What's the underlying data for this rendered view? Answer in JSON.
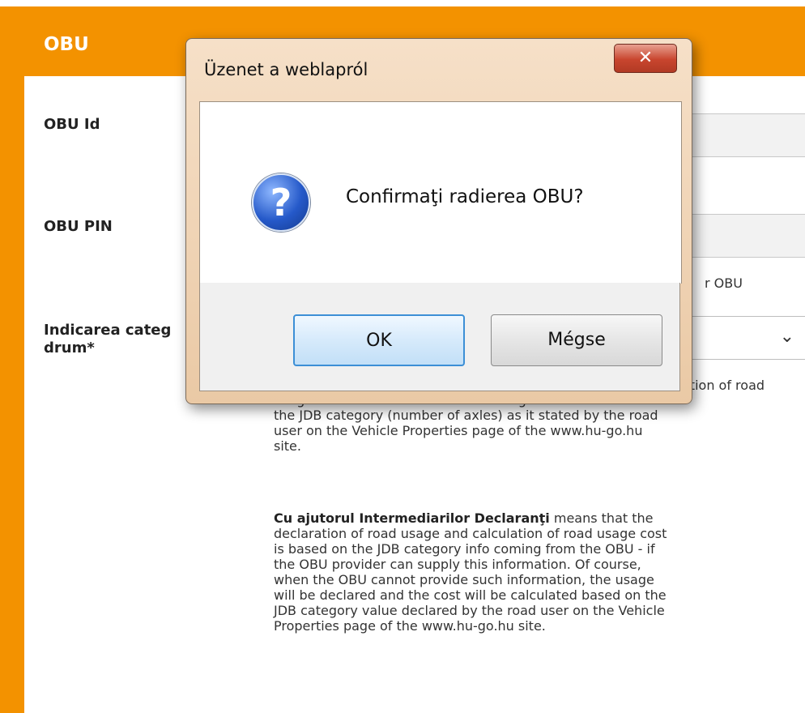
{
  "panel": {
    "title": "OBU",
    "accent_color": "#f39200"
  },
  "form": {
    "obu_id_label": "OBU Id",
    "obu_pin_label": "OBU PIN",
    "obu_hint_partial": "r OBU",
    "category_label_line1": "Indicarea categ",
    "category_label_line2": "drum*",
    "category_select_chevron": "chevron-down-icon",
    "desc_para1_partial": "ation of road",
    "desc_para1_lines": [
      "usage and the calculation of road usage cost are based on",
      "the JDB category (number of axles) as it stated by the road",
      "user on the Vehicle Properties page of the www.hu-go.hu",
      "site."
    ],
    "desc_para2_bold": "Cu ajutorul Intermediarilor Declaranţi",
    "desc_para2_rest": " means that the",
    "desc_para2_lines": [
      "declaration of road usage and calculation of road usage cost",
      "is based on the JDB category info coming from the OBU - if",
      "the OBU provider can supply this information. Of course,",
      "when the OBU cannot provide such information, the usage",
      "will be declared and the cost will be calculated based on the",
      "JDB category value declared by the road user on the Vehicle",
      "Properties page of the www.hu-go.hu site."
    ]
  },
  "dialog": {
    "title": "Üzenet a weblapról",
    "close_icon": "close-icon",
    "question_icon": "question-icon",
    "message": "Confirmaţi radierea OBU?",
    "ok_label": "OK",
    "cancel_label": "Mégse"
  }
}
